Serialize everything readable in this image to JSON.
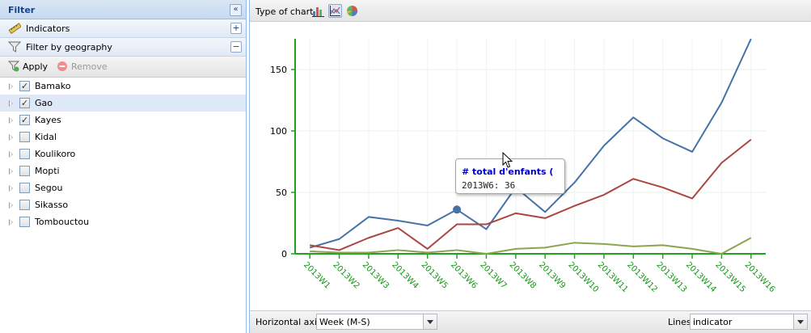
{
  "left_panel": {
    "title": "Filter",
    "sections": [
      {
        "label": "Indicators",
        "toggle": "+"
      },
      {
        "label": "Filter by geography",
        "toggle": "−"
      }
    ],
    "toolbar": {
      "apply_label": "Apply",
      "remove_label": "Remove"
    },
    "regions": [
      {
        "name": "Bamako",
        "checked": true,
        "selected": false
      },
      {
        "name": "Gao",
        "checked": true,
        "selected": true
      },
      {
        "name": "Kayes",
        "checked": true,
        "selected": false
      },
      {
        "name": "Kidal",
        "checked": false,
        "selected": false
      },
      {
        "name": "Koulikoro",
        "checked": false,
        "selected": false
      },
      {
        "name": "Mopti",
        "checked": false,
        "selected": false
      },
      {
        "name": "Segou",
        "checked": false,
        "selected": false
      },
      {
        "name": "Sikasso",
        "checked": false,
        "selected": false
      },
      {
        "name": "Tombouctou",
        "checked": false,
        "selected": false
      }
    ]
  },
  "chart_panel": {
    "type_of_chart_label": "Type of chart",
    "chart_type_icons": [
      "bar-chart-icon",
      "line-chart-icon",
      "pie-chart-icon"
    ],
    "active_chart_type": "line",
    "horizontal_axis_label": "Horizontal axis",
    "horizontal_axis_value": "Week (M-S)",
    "lines_label": "Lines",
    "lines_value": "indicator",
    "tooltip": {
      "title": "# total d'enfants (",
      "value": "2013W6: 36"
    }
  },
  "chart_data": {
    "type": "line",
    "x": [
      "2013W1",
      "2013W2",
      "2013W3",
      "2013W4",
      "2013W5",
      "2013W6",
      "2013W7",
      "2013W8",
      "2013W9",
      "2013W10",
      "2013W11",
      "2013W12",
      "2013W13",
      "2013W14",
      "2013W15",
      "2013W16"
    ],
    "ylim": [
      0,
      175
    ],
    "yticks": [
      0,
      50,
      100,
      150
    ],
    "grid": true,
    "series": [
      {
        "color": "#4572a7",
        "values": [
          5,
          12,
          30,
          27,
          23,
          36,
          20,
          54,
          34,
          58,
          88,
          111,
          94,
          83,
          123,
          175
        ]
      },
      {
        "color": "#aa4643",
        "values": [
          7,
          3,
          13,
          21,
          4,
          24,
          24,
          33,
          29,
          39,
          48,
          61,
          54,
          45,
          74,
          93
        ]
      },
      {
        "color": "#89a54e",
        "values": [
          2,
          1,
          1,
          3,
          1,
          3,
          0,
          4,
          5,
          9,
          8,
          6,
          7,
          4,
          0,
          13
        ]
      }
    ],
    "highlight": {
      "series": 0,
      "index": 5
    }
  }
}
